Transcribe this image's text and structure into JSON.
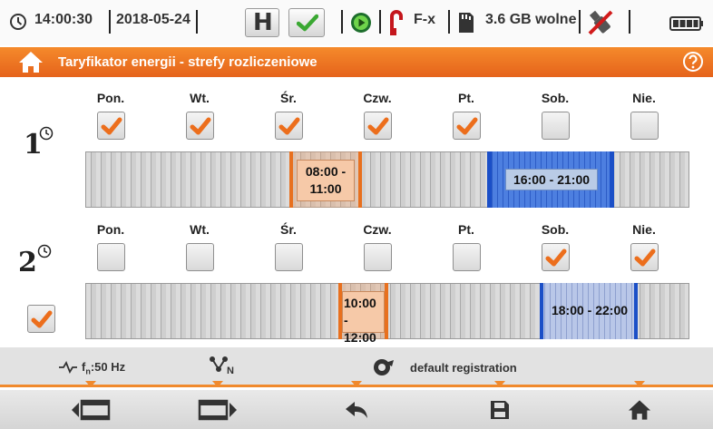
{
  "status": {
    "time": "14:00:30",
    "date": "2018-05-24",
    "hold_label": "H",
    "clamp_label": "F-x",
    "memory": "3.6 GB wolne"
  },
  "header": {
    "title": "Taryfikator energii - strefy rozliczeniowe"
  },
  "zone1": {
    "days": [
      {
        "label": "Pon.",
        "checked": true
      },
      {
        "label": "Wt.",
        "checked": true
      },
      {
        "label": "Śr.",
        "checked": true
      },
      {
        "label": "Czw.",
        "checked": true
      },
      {
        "label": "Pt.",
        "checked": true
      },
      {
        "label": "Sob.",
        "checked": false
      },
      {
        "label": "Nie.",
        "checked": false
      }
    ],
    "ranges": [
      {
        "line1": "08:00 -",
        "line2": "11:00"
      },
      {
        "text": "16:00 - 21:00"
      }
    ]
  },
  "zone2": {
    "enabled": true,
    "days": [
      {
        "label": "Pon.",
        "checked": false
      },
      {
        "label": "Wt.",
        "checked": false
      },
      {
        "label": "Śr.",
        "checked": false
      },
      {
        "label": "Czw.",
        "checked": false
      },
      {
        "label": "Pt.",
        "checked": false
      },
      {
        "label": "Sob.",
        "checked": true
      },
      {
        "label": "Nie.",
        "checked": true
      }
    ],
    "ranges": [
      {
        "line1": "10:00 -",
        "line2": "12:00"
      },
      {
        "text": "18:00 - 22:00"
      }
    ]
  },
  "infobar": {
    "freq": "f",
    "freq_sub": "n",
    "freq_value": ":50 Hz",
    "network_sub": "N",
    "registration": "default registration"
  },
  "colors": {
    "accent": "#f0892c",
    "check": "#ec6e1c",
    "range_blue": "#1b4fc7"
  },
  "icons": [
    "clock-icon",
    "hold-icon",
    "check-icon",
    "record-icon",
    "clamp-icon",
    "sd-card-icon",
    "no-usb-icon",
    "battery-icon",
    "home-icon",
    "help-icon",
    "zone-1-icon",
    "zone-2-icon",
    "waveform-icon",
    "network-icon",
    "registration-icon",
    "prev-screen-icon",
    "next-screen-icon",
    "back-icon",
    "save-icon",
    "home-icon"
  ]
}
